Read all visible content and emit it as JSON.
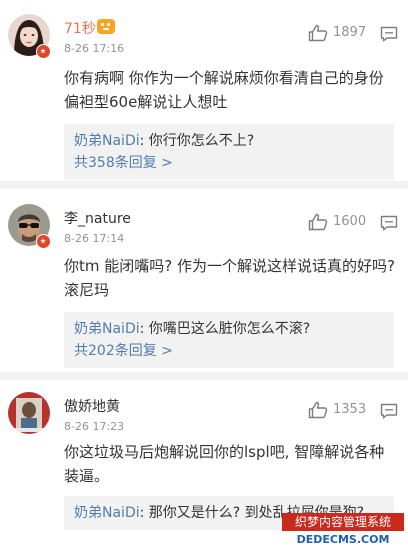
{
  "comments": [
    {
      "user": "71秒",
      "time": "8-26 17:16",
      "likes": "1897",
      "text": "你有病啊 你作为一个解说麻烦你看清自己的身份 偏袒型60e解说让人想吐",
      "reply": {
        "author": "奶弟NaiDi",
        "sep": ": ",
        "text": "你行你怎么不上?"
      },
      "more": "共358条回复 >"
    },
    {
      "user": "李_nature",
      "time": "8-26 17:14",
      "likes": "1600",
      "text": "你tm 能闭嘴吗? 作为一个解说这样说话真的好吗? 滚尼玛",
      "reply": {
        "author": "奶弟NaiDi",
        "sep": ": ",
        "text": "你嘴巴这么脏你怎么不滚?"
      },
      "more": "共202条回复 >"
    },
    {
      "user": "傲娇地黄",
      "time": "8-26 17:23",
      "likes": "1353",
      "text": "你这垃圾马后炮解说回你的lspl吧, 智障解说各种装逼。",
      "reply": {
        "author": "奶弟NaiDi",
        "sep": ": ",
        "text": "那你又是什么? 到处乱拉屎你是狗?"
      }
    }
  ],
  "watermark": {
    "top": "织梦内容管理系统",
    "bottom": "DEDECMS.COM"
  },
  "colors": {
    "link": "#507daf",
    "name_orange": "#eb7350",
    "meta": "#939393",
    "panel": "#f2f2f2"
  }
}
